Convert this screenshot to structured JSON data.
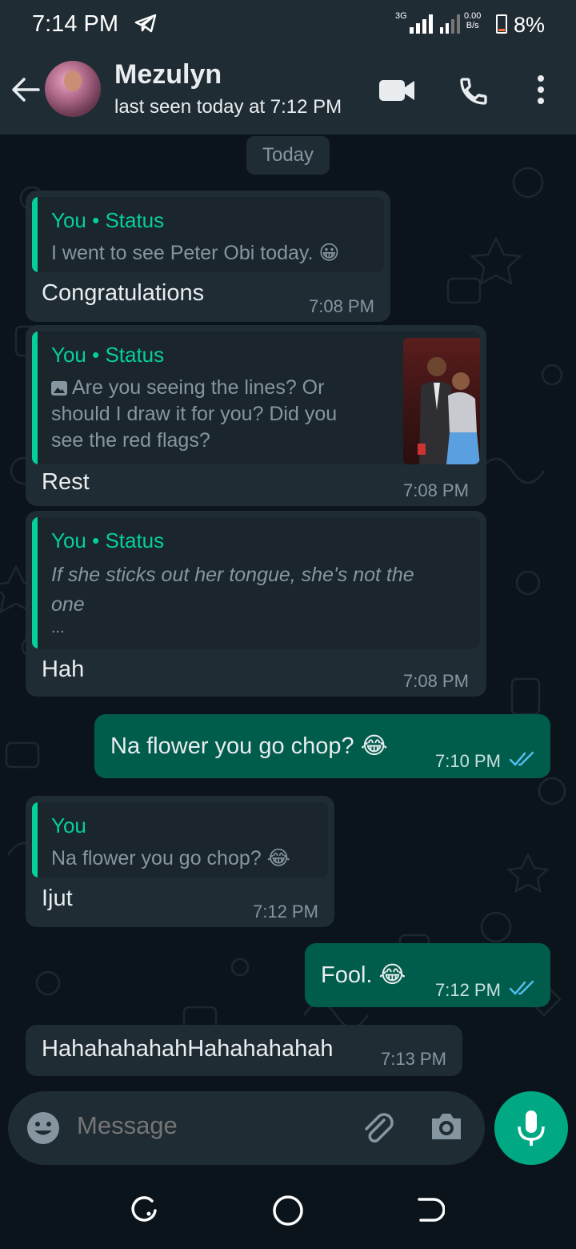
{
  "status_bar": {
    "time": "7:14 PM",
    "network": "3G",
    "speed_top": "0.00",
    "speed_bottom": "B/s",
    "battery": "8%"
  },
  "header": {
    "contact_name": "Mezulyn",
    "last_seen": "last seen today at 7:12 PM",
    "icons": [
      "back-arrow-icon",
      "video-call-icon",
      "voice-call-icon",
      "more-options-icon"
    ]
  },
  "chat": {
    "day_label": "Today",
    "messages": [
      {
        "direction": "incoming",
        "quote_author": "You",
        "quote_source": "Status",
        "quote_text": "I went to see Peter Obi today. 😀",
        "text": "Congratulations",
        "time": "7:08 PM"
      },
      {
        "direction": "incoming",
        "quote_author": "You",
        "quote_source": "Status",
        "quote_lines": [
          "Are you seeing the lines? Or",
          "should I draw it for you? Did you",
          "see the red flags?"
        ],
        "text": "Rest",
        "time": "7:08 PM"
      },
      {
        "direction": "incoming",
        "quote_author": "You",
        "quote_source": "Status",
        "quote_lines": [
          "If she sticks out her tongue, she's not the",
          "one",
          "..."
        ],
        "text": "Hah",
        "time": "7:08 PM"
      },
      {
        "direction": "outgoing",
        "text": "Na flower you go chop? 😂",
        "time": "7:10 PM"
      },
      {
        "direction": "incoming",
        "quote_author": "You",
        "quote_text": "Na flower you go chop? 😂",
        "text": "Ijut",
        "time": "7:12 PM"
      },
      {
        "direction": "outgoing",
        "text": "Fool. 😂",
        "time": "7:12 PM"
      },
      {
        "direction": "incoming",
        "text": "HahahahahahHahahahahah",
        "time": "7:13 PM"
      }
    ]
  },
  "input": {
    "placeholder": "Message"
  },
  "colors": {
    "incoming_bubble": "#1f2c34",
    "outgoing_bubble": "#005c4b",
    "accent": "#00a884",
    "quote_author": "#06cf9c"
  }
}
